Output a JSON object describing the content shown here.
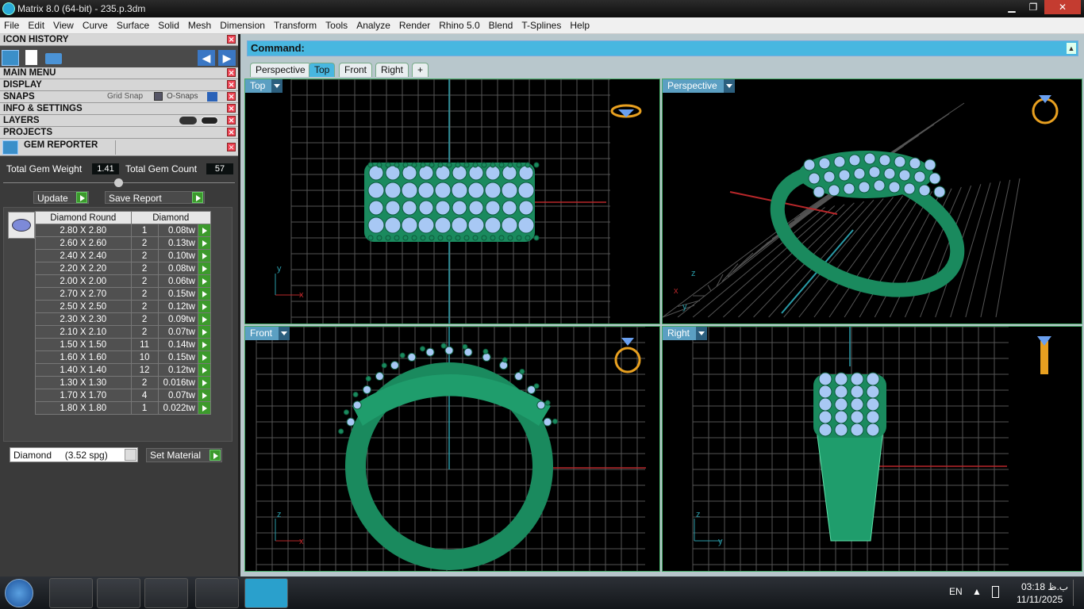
{
  "window": {
    "title": "Matrix 8.0 (64-bit) - 235.p.3dm"
  },
  "menu": [
    "File",
    "Edit",
    "View",
    "Curve",
    "Surface",
    "Solid",
    "Mesh",
    "Dimension",
    "Transform",
    "Tools",
    "Analyze",
    "Render",
    "Rhino 5.0",
    "Blend",
    "T-Splines",
    "Help"
  ],
  "panel": {
    "icon_history": "ICON HISTORY",
    "main_menu": "MAIN MENU",
    "display": "DISPLAY",
    "snaps": "SNAPS",
    "grid_snap": "Grid Snap",
    "o_snaps": "O-Snaps",
    "info_settings": "INFO & SETTINGS",
    "layers": "LAYERS",
    "projects": "PROJECTS",
    "gem_reporter": "GEM REPORTER"
  },
  "gem": {
    "total_weight_label": "Total Gem Weight",
    "total_weight": "1.41",
    "total_count_label": "Total Gem Count",
    "total_count": "57",
    "update": "Update",
    "save_report": "Save Report",
    "col1": "Diamond Round",
    "col2": "Diamond",
    "rows": [
      {
        "size": "2.80 X 2.80",
        "qty": "1",
        "weight": "0.08tw"
      },
      {
        "size": "2.60 X 2.60",
        "qty": "2",
        "weight": "0.13tw"
      },
      {
        "size": "2.40 X 2.40",
        "qty": "2",
        "weight": "0.10tw"
      },
      {
        "size": "2.20 X 2.20",
        "qty": "2",
        "weight": "0.08tw"
      },
      {
        "size": "2.00 X 2.00",
        "qty": "2",
        "weight": "0.06tw"
      },
      {
        "size": "2.70 X 2.70",
        "qty": "2",
        "weight": "0.15tw"
      },
      {
        "size": "2.50 X 2.50",
        "qty": "2",
        "weight": "0.12tw"
      },
      {
        "size": "2.30 X 2.30",
        "qty": "2",
        "weight": "0.09tw"
      },
      {
        "size": "2.10 X 2.10",
        "qty": "2",
        "weight": "0.07tw"
      },
      {
        "size": "1.50 X 1.50",
        "qty": "11",
        "weight": "0.14tw"
      },
      {
        "size": "1.60 X 1.60",
        "qty": "10",
        "weight": "0.15tw"
      },
      {
        "size": "1.40 X 1.40",
        "qty": "12",
        "weight": "0.12tw"
      },
      {
        "size": "1.30 X 1.30",
        "qty": "2",
        "weight": "0.016tw"
      },
      {
        "size": "1.70 X 1.70",
        "qty": "4",
        "weight": "0.07tw"
      },
      {
        "size": "1.80 X 1.80",
        "qty": "1",
        "weight": "0.022tw"
      }
    ],
    "material_select": "Diamond     (3.52 spg)",
    "set_material": "Set Material"
  },
  "command_label": "Command:",
  "tabs": [
    "Perspective",
    "Top",
    "Front",
    "Right",
    "+"
  ],
  "active_tab": "Top",
  "viewports": {
    "top": "Top",
    "perspective": "Perspective",
    "front": "Front",
    "right": "Right"
  },
  "axis": {
    "x": "x",
    "y": "y",
    "z": "z"
  },
  "taskbar": {
    "lang": "EN",
    "time": "03:18 ب.ظ",
    "date": "11/11/2025"
  },
  "colors": {
    "accent": "#48b7e0",
    "gem": "#a8c8f4",
    "metal": "#1fa070"
  }
}
